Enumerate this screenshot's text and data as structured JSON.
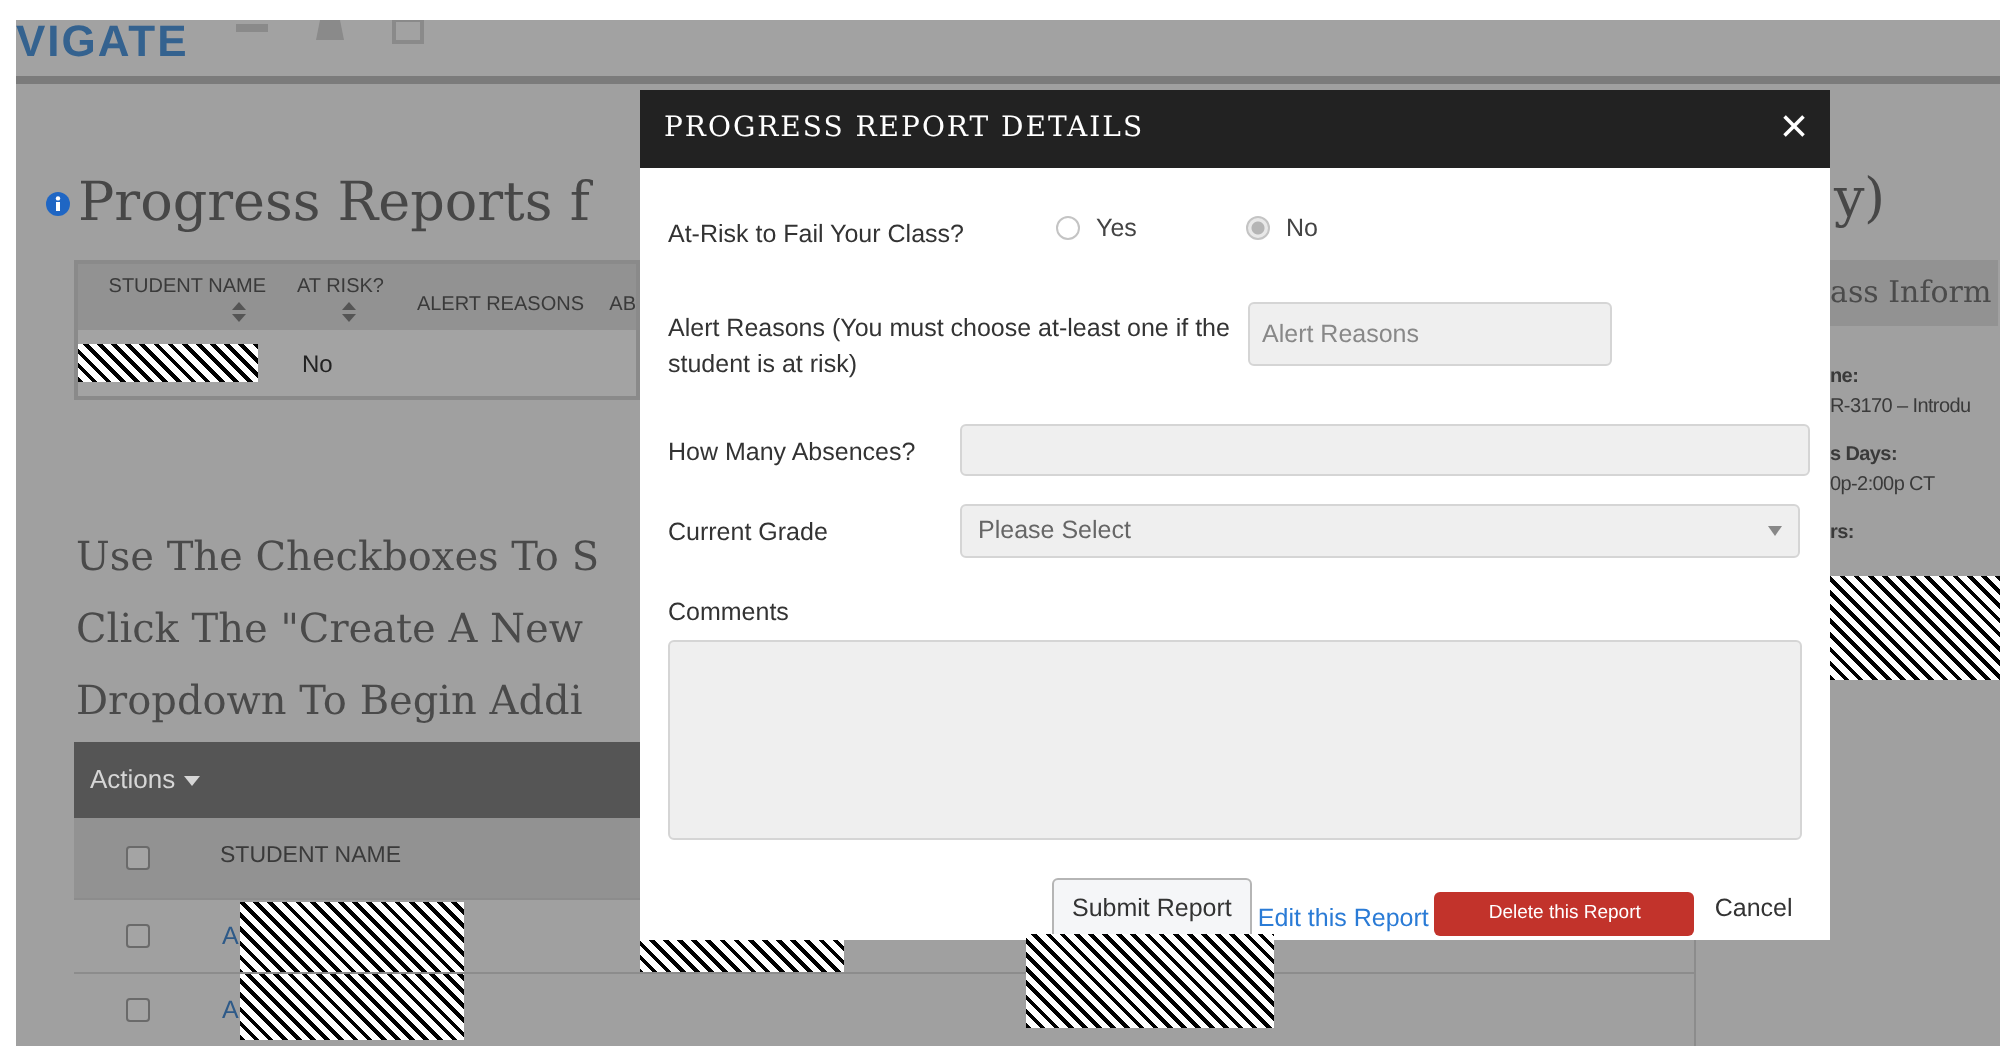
{
  "top_bar": {
    "logo": "VIGATE"
  },
  "page_title": {
    "left": "Progress Reports f",
    "right": "y)"
  },
  "reports_table": {
    "columns": [
      {
        "label": "STUDENT NAME",
        "sortable": true
      },
      {
        "label": "AT RISK?",
        "sortable": true
      },
      {
        "label": "ALERT REASONS",
        "sortable": false
      },
      {
        "label": "AB",
        "sortable": false
      }
    ],
    "rows": [
      {
        "redacted": true,
        "at_risk": "No"
      }
    ]
  },
  "instructions": [
    "Use The Checkboxes To S",
    "Click The \"Create A New",
    "Dropdown To Begin Addi"
  ],
  "students_table": {
    "actions": "Actions",
    "header_checked": false,
    "columns": [
      "STUDENT NAME"
    ],
    "rows": [
      {
        "name": "A",
        "checked": false,
        "redacted": true
      },
      {
        "name": "A",
        "checked": false,
        "redacted": true
      }
    ]
  },
  "class_info": {
    "title": "ass Inform",
    "fields": [
      {
        "label": "ne:",
        "value": "R-3170 – Introdu"
      },
      {
        "label": "s Days:",
        "value": "0p-2:00p CT"
      },
      {
        "label": "rs:",
        "redacted": true
      }
    ]
  },
  "modal": {
    "title": "PROGRESS REPORT DETAILS",
    "close": "×",
    "fields": [
      {
        "kind": "radio",
        "label": "At-Risk to Fail Your Class?",
        "disabled": true,
        "options": [
          {
            "label": "Yes",
            "selected": false
          },
          {
            "label": "No",
            "selected": true
          }
        ]
      },
      {
        "kind": "text",
        "label": "Alert Reasons (You must choose at-least one if the student is at risk)",
        "placeholder": "Alert Reasons",
        "disabled": true
      },
      {
        "kind": "text",
        "label": "How Many Absences?",
        "disabled": true
      },
      {
        "kind": "select",
        "label": "Current Grade",
        "value": "Please Select",
        "disabled": true
      },
      {
        "kind": "textarea",
        "label": "Comments",
        "disabled": true
      }
    ],
    "actions": [
      {
        "kind": "button",
        "label": "Submit Report"
      },
      {
        "kind": "link",
        "label": "Edit this Report"
      },
      {
        "kind": "danger",
        "label": "Delete this Report"
      },
      {
        "kind": "plain",
        "label": "Cancel"
      }
    ]
  }
}
